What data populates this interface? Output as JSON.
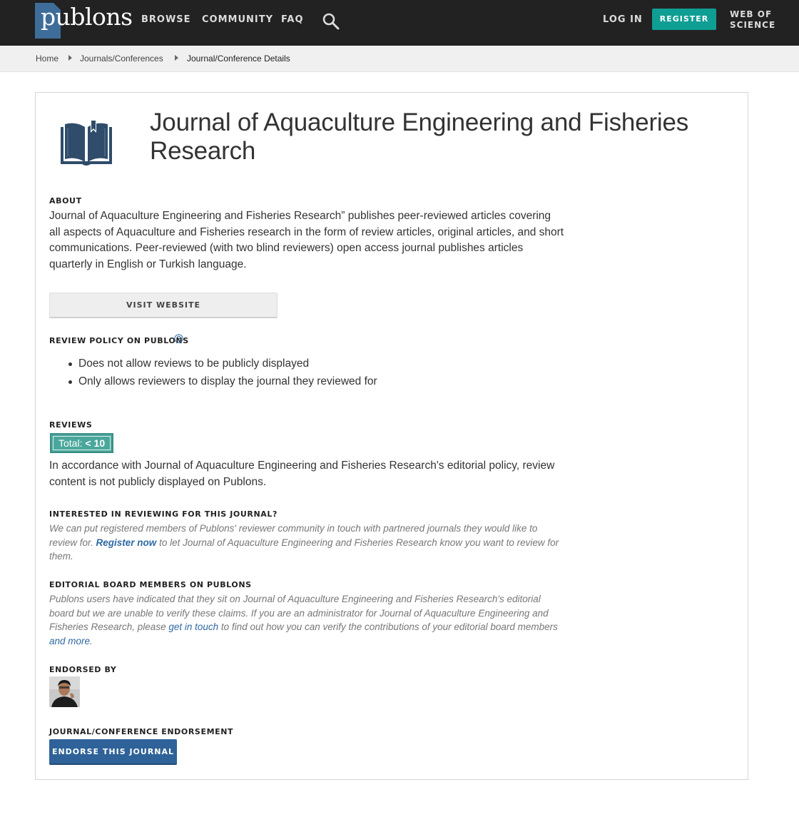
{
  "nav": {
    "logo": "publons",
    "links": [
      "BROWSE",
      "COMMUNITY",
      "FAQ"
    ],
    "login": "LOG IN",
    "register": "REGISTER",
    "wos_line1": "WEB OF",
    "wos_line2": "SCIENCE",
    "search_icon": "search-icon"
  },
  "breadcrumb": [
    "Home",
    "Journals/Conferences",
    "Journal/Conference Details"
  ],
  "journal": {
    "title": "Journal of Aquaculture Engineering and Fisheries Research",
    "icon": "open-book-icon"
  },
  "about": {
    "label": "ABOUT",
    "text": "Journal of Aquaculture Engineering and Fisheries Research” publishes peer-reviewed articles covering all aspects of Aquaculture and Fisheries research in the form of review articles, original articles, and short communications. Peer-reviewed (with two blind reviewers) open access journal publishes articles quarterly in English or Turkish language.",
    "visit_button": "VISIT WEBSITE"
  },
  "review_policy": {
    "label": "REVIEW POLICY ON PUBLONS",
    "items": [
      "Does not allow reviews to be publicly displayed",
      "Only allows reviewers to display the journal they reviewed for"
    ]
  },
  "reviews": {
    "label": "REVIEWS",
    "total_label": "Total:",
    "total_value": "< 10",
    "text": "In accordance with Journal of Aquaculture Engineering and Fisheries Research's editorial policy, review content is not publicly displayed on Publons."
  },
  "interested": {
    "label": "INTERESTED IN REVIEWING FOR THIS JOURNAL?",
    "text_before": "We can put registered members of Publons' reviewer community in touch with partnered journals they would like to review for.",
    "link": "Register now",
    "text_after": "to let Journal of Aquaculture Engineering and Fisheries Research know you want to review for them."
  },
  "editorial": {
    "label": "EDITORIAL BOARD MEMBERS ON PUBLONS",
    "text_before": "Publons users have indicated that they sit on Journal of Aquaculture Engineering and Fisheries Research's editorial board but we are unable to verify these claims. If you are an administrator for Journal of Aquaculture Engineering and Fisheries Research, please",
    "link1": "get in touch",
    "text_middle": "to find out how you can verify the contributions of your editorial board members",
    "link2": "and more",
    "text_end": "."
  },
  "endorsed": {
    "label": "ENDORSED BY"
  },
  "endorsement": {
    "label": "JOURNAL/CONFERENCE ENDORSEMENT",
    "button": "ENDORSE THIS JOURNAL"
  },
  "colors": {
    "nav_bg": "#222222",
    "logo_blue": "#3e6d9a",
    "register_teal": "#0f9e94",
    "badge_green": "#4aa79b",
    "link_blue": "#2f69a3",
    "endorse_blue": "#2e6298"
  }
}
